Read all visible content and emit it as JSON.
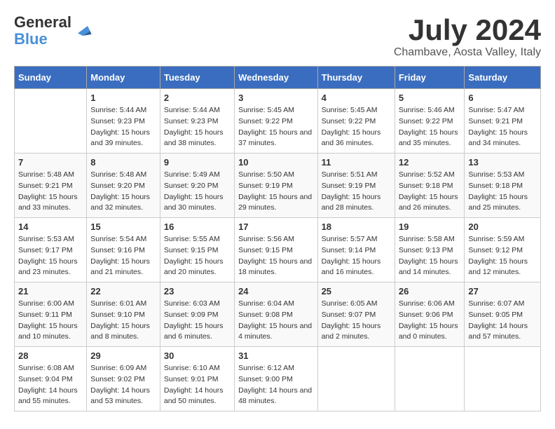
{
  "header": {
    "logo_line1": "General",
    "logo_line2": "Blue",
    "month": "July 2024",
    "location": "Chambave, Aosta Valley, Italy"
  },
  "days_of_week": [
    "Sunday",
    "Monday",
    "Tuesday",
    "Wednesday",
    "Thursday",
    "Friday",
    "Saturday"
  ],
  "weeks": [
    [
      {
        "day": "",
        "sunrise": "",
        "sunset": "",
        "daylight": ""
      },
      {
        "day": "1",
        "sunrise": "Sunrise: 5:44 AM",
        "sunset": "Sunset: 9:23 PM",
        "daylight": "Daylight: 15 hours and 39 minutes."
      },
      {
        "day": "2",
        "sunrise": "Sunrise: 5:44 AM",
        "sunset": "Sunset: 9:23 PM",
        "daylight": "Daylight: 15 hours and 38 minutes."
      },
      {
        "day": "3",
        "sunrise": "Sunrise: 5:45 AM",
        "sunset": "Sunset: 9:22 PM",
        "daylight": "Daylight: 15 hours and 37 minutes."
      },
      {
        "day": "4",
        "sunrise": "Sunrise: 5:45 AM",
        "sunset": "Sunset: 9:22 PM",
        "daylight": "Daylight: 15 hours and 36 minutes."
      },
      {
        "day": "5",
        "sunrise": "Sunrise: 5:46 AM",
        "sunset": "Sunset: 9:22 PM",
        "daylight": "Daylight: 15 hours and 35 minutes."
      },
      {
        "day": "6",
        "sunrise": "Sunrise: 5:47 AM",
        "sunset": "Sunset: 9:21 PM",
        "daylight": "Daylight: 15 hours and 34 minutes."
      }
    ],
    [
      {
        "day": "7",
        "sunrise": "Sunrise: 5:48 AM",
        "sunset": "Sunset: 9:21 PM",
        "daylight": "Daylight: 15 hours and 33 minutes."
      },
      {
        "day": "8",
        "sunrise": "Sunrise: 5:48 AM",
        "sunset": "Sunset: 9:20 PM",
        "daylight": "Daylight: 15 hours and 32 minutes."
      },
      {
        "day": "9",
        "sunrise": "Sunrise: 5:49 AM",
        "sunset": "Sunset: 9:20 PM",
        "daylight": "Daylight: 15 hours and 30 minutes."
      },
      {
        "day": "10",
        "sunrise": "Sunrise: 5:50 AM",
        "sunset": "Sunset: 9:19 PM",
        "daylight": "Daylight: 15 hours and 29 minutes."
      },
      {
        "day": "11",
        "sunrise": "Sunrise: 5:51 AM",
        "sunset": "Sunset: 9:19 PM",
        "daylight": "Daylight: 15 hours and 28 minutes."
      },
      {
        "day": "12",
        "sunrise": "Sunrise: 5:52 AM",
        "sunset": "Sunset: 9:18 PM",
        "daylight": "Daylight: 15 hours and 26 minutes."
      },
      {
        "day": "13",
        "sunrise": "Sunrise: 5:53 AM",
        "sunset": "Sunset: 9:18 PM",
        "daylight": "Daylight: 15 hours and 25 minutes."
      }
    ],
    [
      {
        "day": "14",
        "sunrise": "Sunrise: 5:53 AM",
        "sunset": "Sunset: 9:17 PM",
        "daylight": "Daylight: 15 hours and 23 minutes."
      },
      {
        "day": "15",
        "sunrise": "Sunrise: 5:54 AM",
        "sunset": "Sunset: 9:16 PM",
        "daylight": "Daylight: 15 hours and 21 minutes."
      },
      {
        "day": "16",
        "sunrise": "Sunrise: 5:55 AM",
        "sunset": "Sunset: 9:15 PM",
        "daylight": "Daylight: 15 hours and 20 minutes."
      },
      {
        "day": "17",
        "sunrise": "Sunrise: 5:56 AM",
        "sunset": "Sunset: 9:15 PM",
        "daylight": "Daylight: 15 hours and 18 minutes."
      },
      {
        "day": "18",
        "sunrise": "Sunrise: 5:57 AM",
        "sunset": "Sunset: 9:14 PM",
        "daylight": "Daylight: 15 hours and 16 minutes."
      },
      {
        "day": "19",
        "sunrise": "Sunrise: 5:58 AM",
        "sunset": "Sunset: 9:13 PM",
        "daylight": "Daylight: 15 hours and 14 minutes."
      },
      {
        "day": "20",
        "sunrise": "Sunrise: 5:59 AM",
        "sunset": "Sunset: 9:12 PM",
        "daylight": "Daylight: 15 hours and 12 minutes."
      }
    ],
    [
      {
        "day": "21",
        "sunrise": "Sunrise: 6:00 AM",
        "sunset": "Sunset: 9:11 PM",
        "daylight": "Daylight: 15 hours and 10 minutes."
      },
      {
        "day": "22",
        "sunrise": "Sunrise: 6:01 AM",
        "sunset": "Sunset: 9:10 PM",
        "daylight": "Daylight: 15 hours and 8 minutes."
      },
      {
        "day": "23",
        "sunrise": "Sunrise: 6:03 AM",
        "sunset": "Sunset: 9:09 PM",
        "daylight": "Daylight: 15 hours and 6 minutes."
      },
      {
        "day": "24",
        "sunrise": "Sunrise: 6:04 AM",
        "sunset": "Sunset: 9:08 PM",
        "daylight": "Daylight: 15 hours and 4 minutes."
      },
      {
        "day": "25",
        "sunrise": "Sunrise: 6:05 AM",
        "sunset": "Sunset: 9:07 PM",
        "daylight": "Daylight: 15 hours and 2 minutes."
      },
      {
        "day": "26",
        "sunrise": "Sunrise: 6:06 AM",
        "sunset": "Sunset: 9:06 PM",
        "daylight": "Daylight: 15 hours and 0 minutes."
      },
      {
        "day": "27",
        "sunrise": "Sunrise: 6:07 AM",
        "sunset": "Sunset: 9:05 PM",
        "daylight": "Daylight: 14 hours and 57 minutes."
      }
    ],
    [
      {
        "day": "28",
        "sunrise": "Sunrise: 6:08 AM",
        "sunset": "Sunset: 9:04 PM",
        "daylight": "Daylight: 14 hours and 55 minutes."
      },
      {
        "day": "29",
        "sunrise": "Sunrise: 6:09 AM",
        "sunset": "Sunset: 9:02 PM",
        "daylight": "Daylight: 14 hours and 53 minutes."
      },
      {
        "day": "30",
        "sunrise": "Sunrise: 6:10 AM",
        "sunset": "Sunset: 9:01 PM",
        "daylight": "Daylight: 14 hours and 50 minutes."
      },
      {
        "day": "31",
        "sunrise": "Sunrise: 6:12 AM",
        "sunset": "Sunset: 9:00 PM",
        "daylight": "Daylight: 14 hours and 48 minutes."
      },
      {
        "day": "",
        "sunrise": "",
        "sunset": "",
        "daylight": ""
      },
      {
        "day": "",
        "sunrise": "",
        "sunset": "",
        "daylight": ""
      },
      {
        "day": "",
        "sunrise": "",
        "sunset": "",
        "daylight": ""
      }
    ]
  ]
}
